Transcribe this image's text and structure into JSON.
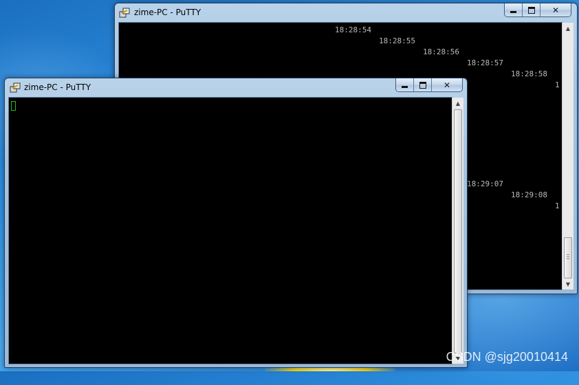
{
  "colors": {
    "accent": "#4aa8ee",
    "terminal_bg": "#000000",
    "terminal_text": "#bbbbbb",
    "cursor": "#22c022"
  },
  "back_window": {
    "title": "zime-PC - PuTTY",
    "icon": "putty-icon",
    "controls": {
      "minimize": "minimize-icon",
      "maximize": "maximize-icon",
      "close": "close-icon"
    },
    "lines": [
      "18:28:54",
      "18:28:55",
      "18:28:56",
      "18:28:57",
      "18:28:58",
      "1",
      "18:29:07",
      "18:29:08",
      "1"
    ]
  },
  "front_window": {
    "title": "zime-PC - PuTTY",
    "icon": "putty-icon",
    "controls": {
      "minimize": "minimize-icon",
      "maximize": "maximize-icon",
      "close": "close-icon"
    }
  },
  "watermark": "CSDN @sjg20010414"
}
